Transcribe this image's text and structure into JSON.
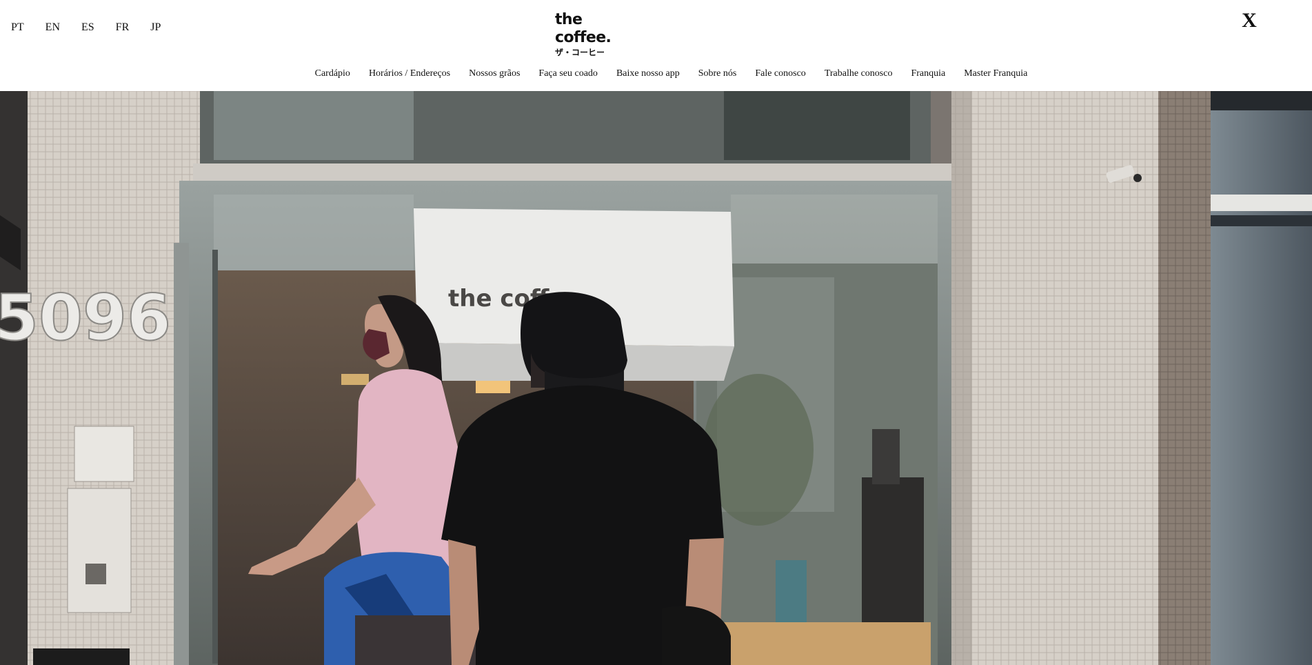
{
  "header": {
    "languages": [
      "PT",
      "EN",
      "ES",
      "FR",
      "JP"
    ],
    "logo": {
      "main": "the coffee.",
      "sub": "ザ・コーヒー"
    },
    "close_label": "X",
    "nav": [
      "Cardápio",
      "Horários / Endereços",
      "Nossos grãos",
      "Faça seu coado",
      "Baixe nosso app",
      "Sobre nós",
      "Fale conosco",
      "Trabalhe conosco",
      "Franquia",
      "Master Franquia"
    ]
  },
  "hero": {
    "storefront_sign": "the coffee.",
    "building_number": "5096"
  }
}
